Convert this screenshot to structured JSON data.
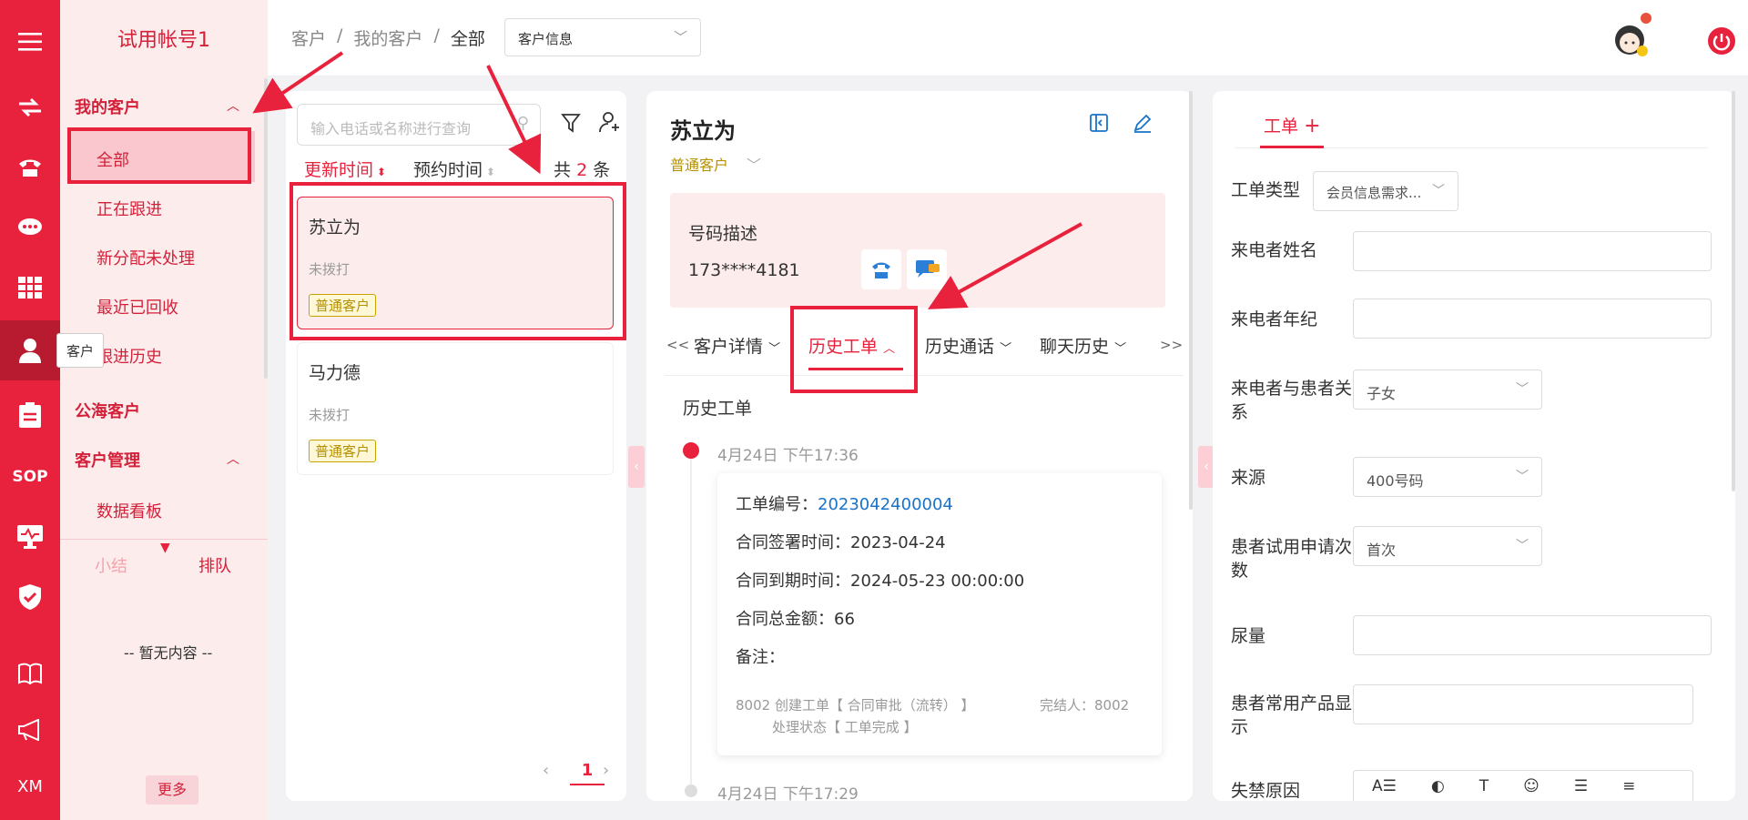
{
  "topbar": {
    "breadcrumb": [
      "客户",
      "我的客户",
      "全部"
    ],
    "breadcrumb_sep": "/",
    "search_type": "客户信息"
  },
  "sidebar": {
    "account": "试用帐号1",
    "group_my": "我的客户",
    "items": [
      "全部",
      "正在跟进",
      "新分配未处理",
      "最近已回收",
      "跟进历史"
    ],
    "group_public": "公海客户",
    "group_manage": "客户管理",
    "manage_items": [
      "数据看板"
    ],
    "tab_summary": "小结",
    "tab_queue": "排队",
    "empty": "-- 暂无内容 --",
    "more": "更多"
  },
  "rail": {
    "tooltip": "客户",
    "sop": "SOP",
    "xm": "XM"
  },
  "list": {
    "search_placeholder": "输入电话或名称进行查询",
    "sort_update": "更新时间",
    "sort_appoint": "预约时间",
    "total_prefix": "共",
    "total_count": "2",
    "total_suffix": "条",
    "customers": [
      {
        "name": "苏立为",
        "status": "未拨打",
        "tag": "普通客户"
      },
      {
        "name": "马力德",
        "status": "未拨打",
        "tag": "普通客户"
      }
    ],
    "page": "1"
  },
  "detail": {
    "name": "苏立为",
    "level": "普通客户",
    "number_desc_label": "号码描述",
    "phone": "173****4181",
    "tabs": [
      "客户详情",
      "历史工单",
      "历史通话",
      "聊天历史"
    ],
    "tab_prev": "<<",
    "tab_next": ">>",
    "section_title": "历史工单",
    "records": [
      {
        "time": "4月24日 下午17:36",
        "order_no_label": "工单编号：",
        "order_no": "2023042400004",
        "sign_label": "合同签署时间：",
        "sign": "2023-04-24",
        "expire_label": "合同到期时间：",
        "expire": "2024-05-23 00:00:00",
        "amount_label": "合同总金额：",
        "amount": "66",
        "remark_label": "备注：",
        "log_line1": "8002 创建工单【 合同审批（流转） 】",
        "log_finisher": "完结人：8002",
        "log_line2": "处理状态【 工单完成 】"
      },
      {
        "time": "4月24日 下午17:29"
      }
    ]
  },
  "form": {
    "tab": "工单",
    "fields": {
      "type_label": "工单类型",
      "type_value": "会员信息需求...",
      "caller_name": "来电者姓名",
      "caller_age": "来电者年纪",
      "relation_label": "来电者与患者关系",
      "relation_value": "子女",
      "source_label": "来源",
      "source_value": "400号码",
      "trial_label": "患者试用申请次数",
      "trial_value": "首次",
      "urine": "尿量",
      "product": "患者常用产品显示",
      "incontinence": "失禁原因"
    }
  },
  "colors": {
    "brand": "#e8213c",
    "link": "#1a73c8",
    "tag": "#b59000"
  }
}
